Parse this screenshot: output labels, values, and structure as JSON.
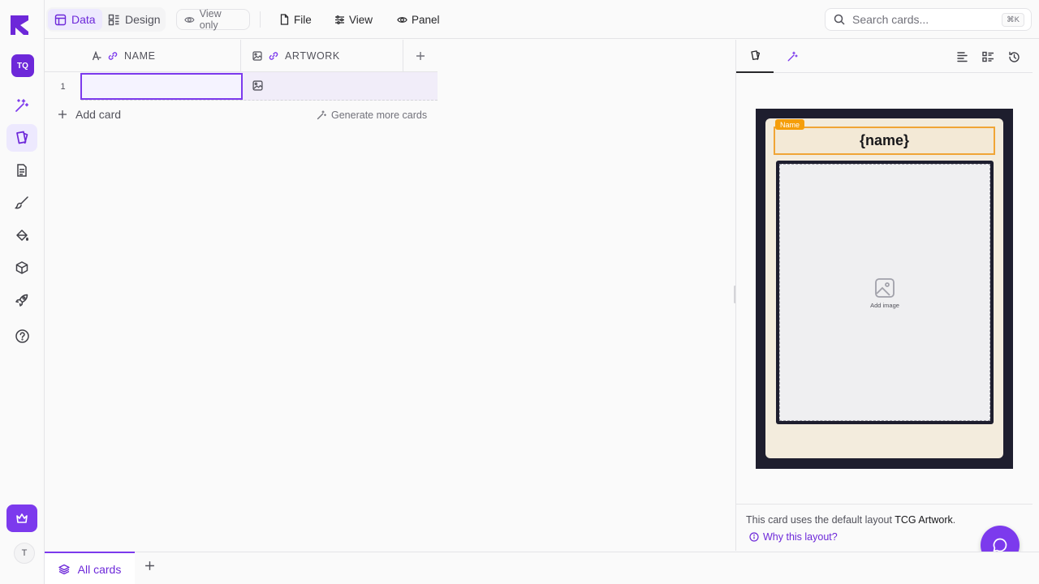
{
  "rail": {
    "workspace_initials": "TQ",
    "user_initial": "T",
    "items": [
      {
        "name": "ai-sparkle-icon"
      },
      {
        "name": "cards-icon"
      },
      {
        "name": "document-icon"
      },
      {
        "name": "brush-icon"
      },
      {
        "name": "paint-bucket-icon"
      },
      {
        "name": "package-icon"
      },
      {
        "name": "rocket-icon"
      },
      {
        "name": "help-icon"
      }
    ]
  },
  "topbar": {
    "data_label": "Data",
    "design_label": "Design",
    "view_only_label": "View only",
    "file_label": "File",
    "view_label": "View",
    "panel_label": "Panel",
    "search_placeholder": "Search cards...",
    "search_shortcut": "⌘K"
  },
  "grid": {
    "columns": [
      {
        "label": "NAME",
        "type_icon": "text-type-icon",
        "link_icon": "link-icon"
      },
      {
        "label": "ARTWORK",
        "type_icon": "image-type-icon",
        "link_icon": "link-icon"
      }
    ],
    "rows": [
      {
        "number": "1",
        "name": "",
        "artwork": ""
      }
    ],
    "add_card_label": "Add card",
    "generate_label": "Generate more cards"
  },
  "preview": {
    "name_tag": "Name",
    "name_placeholder": "{name}",
    "add_image_label": "Add image",
    "footer_text": "This card uses the default layout",
    "layout_name": "TCG Artwork",
    "why_label": "Why this layout?"
  },
  "bottom": {
    "tab_label": "All cards"
  },
  "colors": {
    "accent": "#7c3aed",
    "accent_light": "#ede9fe",
    "card_frame": "#1e1e2e",
    "card_body": "#f3ecdd",
    "name_highlight": "#f59e0b"
  }
}
